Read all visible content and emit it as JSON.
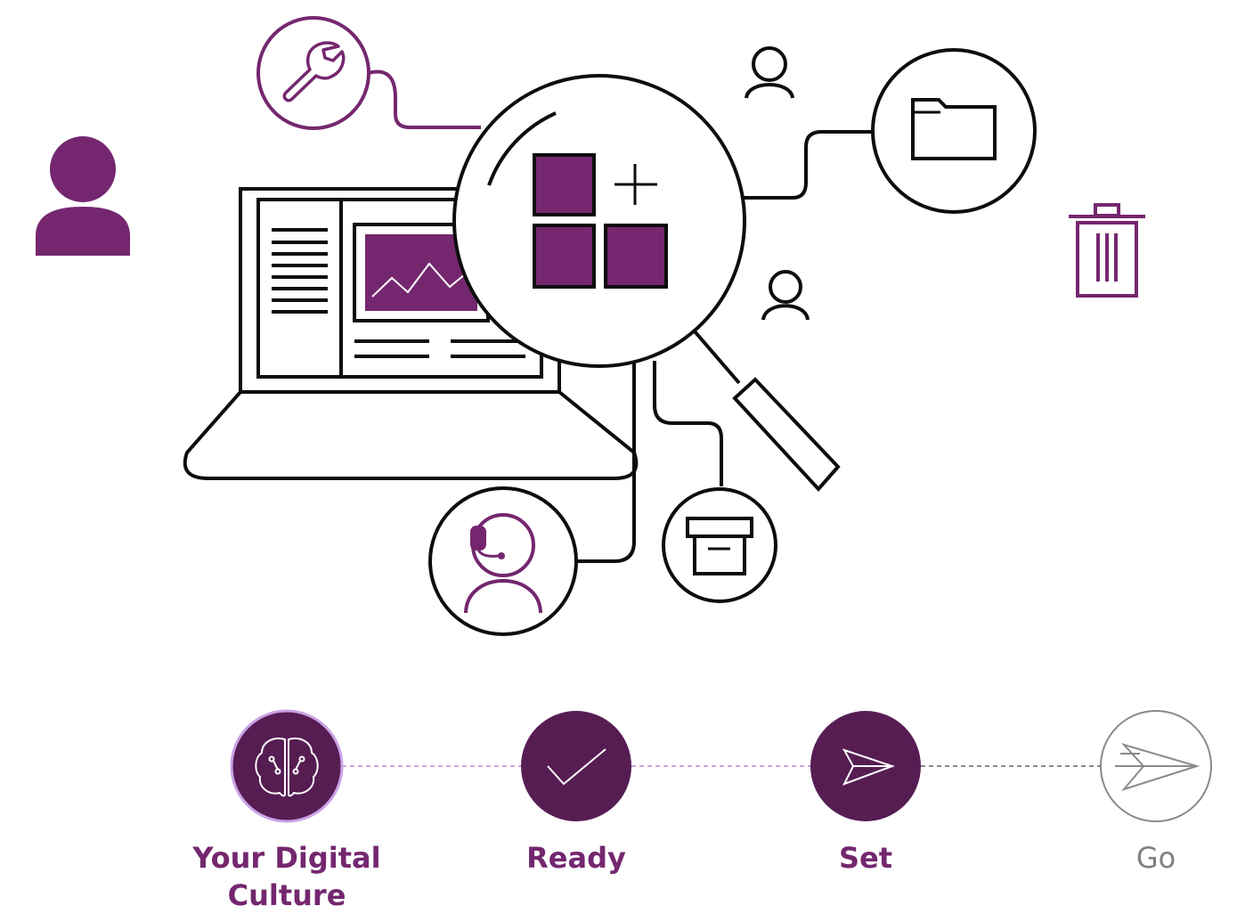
{
  "colors": {
    "accent": "#74276f",
    "step_fill": "#561d53",
    "step_ring": "#c9a2e6",
    "connector_done": "#c9a2e6",
    "connector_pending": "#8a8a8a",
    "pending": "#7f7f7f",
    "line": "#0d0d0d"
  },
  "illustration": {
    "icons": [
      "wrench-icon",
      "user-icon",
      "folder-icon",
      "trash-icon",
      "laptop-icon",
      "magnifier-icon",
      "app-grid-add-icon",
      "headset-support-icon",
      "archive-box-icon"
    ]
  },
  "progress": {
    "steps": [
      {
        "label": "Your Digital Culture",
        "icon": "brain-icon",
        "state": "current"
      },
      {
        "label": "Ready",
        "icon": "checkmark-icon",
        "state": "done"
      },
      {
        "label": "Set",
        "icon": "paper-plane-icon",
        "state": "done"
      },
      {
        "label": "Go",
        "icon": "paper-plane-icon",
        "state": "pending"
      }
    ]
  }
}
